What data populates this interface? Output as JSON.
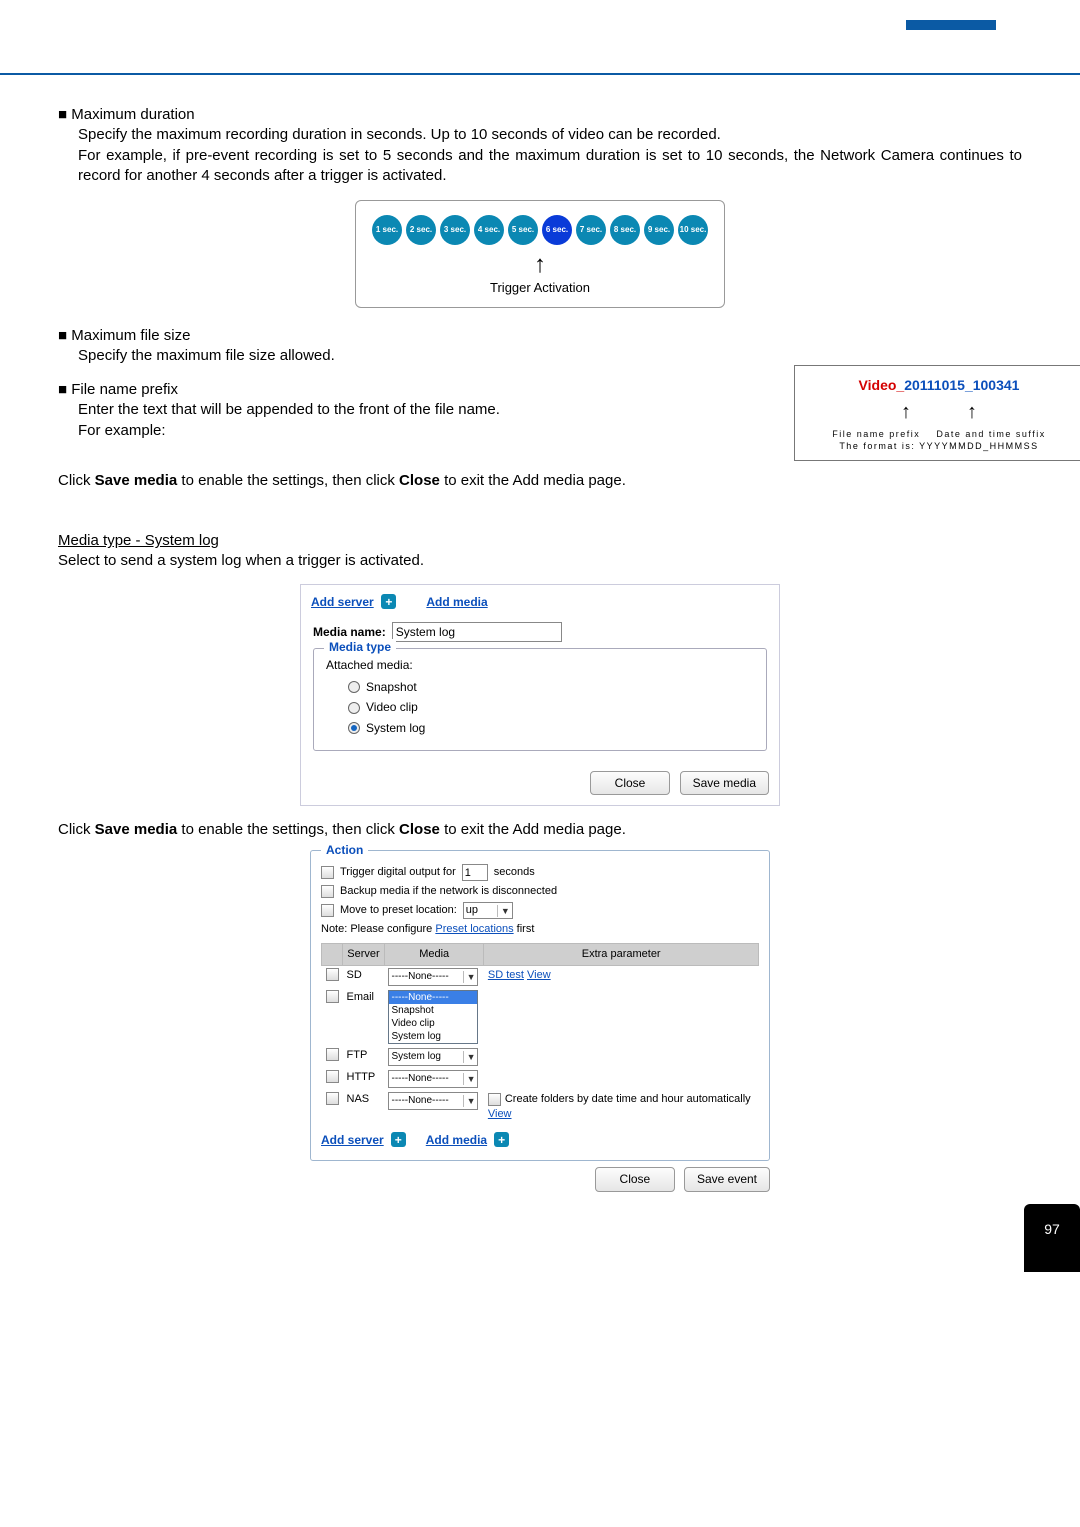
{
  "bullets": {
    "maxDuration": {
      "title": "Maximum duration",
      "desc1": "Specify the maximum recording duration in seconds. Up to 10 seconds of video can be recorded.",
      "desc2": "For example, if pre-event recording is set to 5 seconds and the maximum duration is set to 10 seconds, the Network Camera continues to record for another 4 seconds after a trigger is activated."
    },
    "maxFile": {
      "title": "Maximum file size",
      "desc": "Specify the maximum file size allowed."
    },
    "prefix": {
      "title": "File name prefix",
      "desc1": "Enter the text that will be appended to the front of the file name.",
      "desc2": "For example:"
    }
  },
  "timeline": {
    "labels": [
      "1 sec.",
      "2 sec.",
      "3 sec.",
      "4 sec.",
      "5 sec.",
      "6 sec.",
      "7 sec.",
      "8 sec.",
      "9 sec.",
      "10 sec."
    ],
    "activeIndex": 5,
    "caption": "Trigger Activation"
  },
  "filenameEx": {
    "prefixRed": "Video_",
    "tsBlue": "20111015_100341",
    "line1a": "File name prefix",
    "line1b": "Date and time suffix",
    "line2a": "The format is: YYYYMMDD_HHMMSS"
  },
  "instr1": {
    "pre": "Click ",
    "b1": "Save media",
    "mid": " to enable the settings, then click ",
    "b2": "Close",
    "post": " to exit the Add media page."
  },
  "mediaType": {
    "sectionTitle": "Media type - System log",
    "sectionDesc": "Select to send a system log when a trigger is activated.",
    "addServer": "Add server",
    "addMedia": "Add media",
    "mediaNameLabel": "Media name:",
    "mediaNameValue": "System log",
    "fieldsetTitle": "Media type",
    "attached": "Attached media:",
    "radios": [
      "Snapshot",
      "Video clip",
      "System log"
    ],
    "selected": 2,
    "btnClose": "Close",
    "btnSave": "Save media"
  },
  "instr2": {
    "pre": "Click ",
    "b1": "Save media",
    "mid": " to enable the settings, then click ",
    "b2": "Close",
    "post": " to exit the Add media page."
  },
  "action": {
    "legend": "Action",
    "row1a": "Trigger digital output for",
    "row1value": "1",
    "row1b": "seconds",
    "row2": "Backup media if the network is disconnected",
    "row3a": "Move to preset location:",
    "row3value": "up",
    "notePre": "Note: Please configure ",
    "noteLink": "Preset locations",
    "notePost": " first",
    "th": [
      "Server",
      "Media",
      "Extra parameter"
    ],
    "rows": [
      {
        "srv": "SD",
        "media": "-----None-----",
        "extra_links": [
          "SD test",
          "View"
        ],
        "text": ""
      },
      {
        "srv": "Email",
        "media_open": true,
        "text": ""
      },
      {
        "srv": "FTP",
        "media": "System log",
        "text": ""
      },
      {
        "srv": "HTTP",
        "media": "-----None-----",
        "text": ""
      },
      {
        "srv": "NAS",
        "media": "-----None-----",
        "nas_label": "Create folders by date time and hour automatically",
        "nas_view": "View"
      }
    ],
    "dd_options": [
      "-----None-----",
      "Snapshot",
      "Video clip",
      "System log"
    ],
    "dd_selected": "-----None-----",
    "bottomLinks": {
      "addServer": "Add server",
      "addMedia": "Add media"
    },
    "btnClose": "Close",
    "btnSave": "Save event"
  },
  "pageNum": "97"
}
